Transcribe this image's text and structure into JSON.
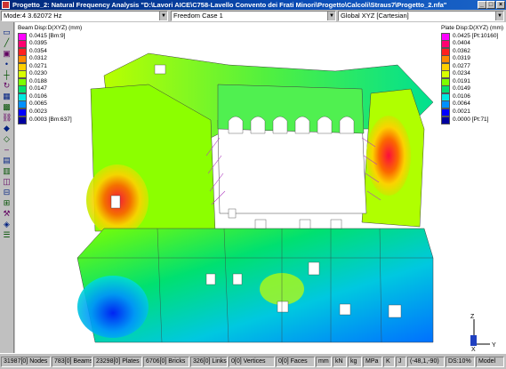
{
  "window": {
    "title": "Progetto_2: Natural Frequency Analysis \"D:\\Lavori AICE\\C758-Lavello Convento dei Frati Minori\\Progetto\\Calcoli\\Straus7\\Progetto_2.nfa\"",
    "buttons": {
      "minimize": "_",
      "maximize": "□",
      "close": "×"
    }
  },
  "toolbar": {
    "mode": "Mode:4  3.62072 Hz",
    "freedom_case": "Freedom Case 1",
    "coordinate_system": "Global XYZ [Cartesian]"
  },
  "left_tools": [
    "select-icon",
    "line-icon",
    "box-icon",
    "node-icon",
    "beam-icon",
    "rotate-icon",
    "plate-icon",
    "brick-icon",
    "link-icon",
    "vertex-icon",
    "face-icon",
    "dash-icon",
    "grid-icon",
    "mesh-icon",
    "cube-icon",
    "sub-icon",
    "extrude-icon",
    "tools-icon",
    "cad-icon",
    "layers-icon"
  ],
  "beam_legend": {
    "title": "Beam Disp:D(XYZ) (mm)",
    "values": [
      "0.0415 [Bm:9]",
      "0.0395",
      "0.0354",
      "0.0312",
      "0.0271",
      "0.0230",
      "0.0188",
      "0.0147",
      "0.0106",
      "0.0065",
      "0.0023",
      "0.0003 [Bm:637]"
    ],
    "colors": [
      "#ff00ff",
      "#ff0070",
      "#ff2020",
      "#ff8a00",
      "#ffd000",
      "#d8ff00",
      "#7dff00",
      "#00e070",
      "#00e8e0",
      "#0090ff",
      "#0000ff",
      "#0000a0"
    ]
  },
  "plate_legend": {
    "title": "Plate Disp:D(XYZ) (mm)",
    "values": [
      "0.0425 [Pt:10160]",
      "0.0404",
      "0.0362",
      "0.0319",
      "0.0277",
      "0.0234",
      "0.0191",
      "0.0149",
      "0.0106",
      "0.0064",
      "0.0021",
      "0.0000 [Pt:71]"
    ],
    "colors": [
      "#ff00ff",
      "#ff0070",
      "#ff2020",
      "#ff8a00",
      "#ffd000",
      "#d8ff00",
      "#7dff00",
      "#00e070",
      "#00e8e0",
      "#0090ff",
      "#0000ff",
      "#0000a0"
    ]
  },
  "axes": {
    "z": "Z",
    "x": "X"
  },
  "statusbar": {
    "nodes": "31987[0] Nodes",
    "beams": "783[0] Beams",
    "plates": "23298[0] Plates",
    "bricks": "6706[0] Bricks",
    "links": "326[0] Links",
    "vertices": "0[0] Vertices",
    "faces": "0[0] Faces",
    "unit_length": "mm",
    "unit_force": "kN",
    "unit_mass": "kg",
    "unit_stress": "MPa",
    "unit_temp": "K",
    "unit_energy": "J",
    "angles": "(-48,1,-90)",
    "ds": "DS:10%",
    "model": "Model"
  }
}
